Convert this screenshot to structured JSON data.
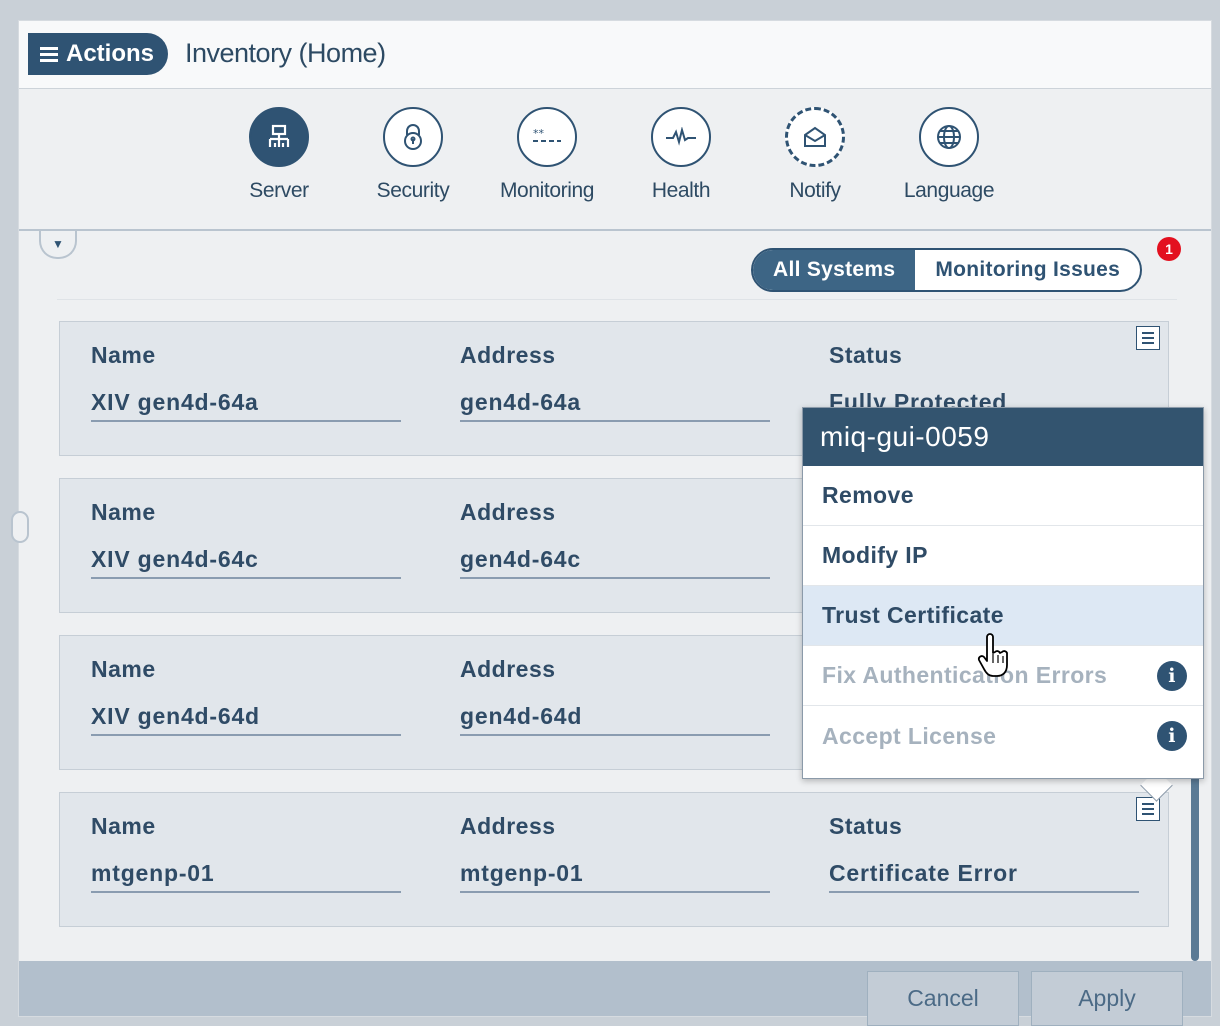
{
  "header": {
    "actions_label": "Actions",
    "title": "Inventory (Home)"
  },
  "nav": {
    "items": [
      {
        "label": "Server",
        "icon": "server-icon",
        "active": true
      },
      {
        "label": "Security",
        "icon": "lock-icon"
      },
      {
        "label": "Monitoring",
        "icon": "monitoring-icon"
      },
      {
        "label": "Health",
        "icon": "pulse-icon"
      },
      {
        "label": "Notify",
        "icon": "envelope-icon"
      },
      {
        "label": "Language",
        "icon": "globe-icon"
      }
    ]
  },
  "filter": {
    "all_systems": "All Systems",
    "monitoring_issues": "Monitoring Issues",
    "issues_badge": "1"
  },
  "columns": {
    "name": "Name",
    "address": "Address",
    "status": "Status"
  },
  "systems": [
    {
      "name": "XIV gen4d-64a",
      "address": "gen4d-64a",
      "status": "Fully Protected"
    },
    {
      "name": "XIV gen4d-64c",
      "address": "gen4d-64c",
      "status": ""
    },
    {
      "name": "XIV gen4d-64d",
      "address": "gen4d-64d",
      "status": ""
    },
    {
      "name": "mtgenp-01",
      "address": "mtgenp-01",
      "status": "Certificate Error"
    }
  ],
  "context_menu": {
    "title": "miq-gui-0059",
    "items": [
      {
        "label": "Remove",
        "state": "enabled"
      },
      {
        "label": "Modify IP",
        "state": "enabled"
      },
      {
        "label": "Trust Certificate",
        "state": "hover"
      },
      {
        "label": "Fix Authentication Errors",
        "state": "disabled",
        "info": true
      },
      {
        "label": "Accept License",
        "state": "disabled",
        "info": true
      }
    ]
  },
  "footer": {
    "cancel": "Cancel",
    "apply": "Apply"
  },
  "colors": {
    "primary": "#2f5373",
    "badge": "#e3101f",
    "hover": "#dde8f4"
  }
}
